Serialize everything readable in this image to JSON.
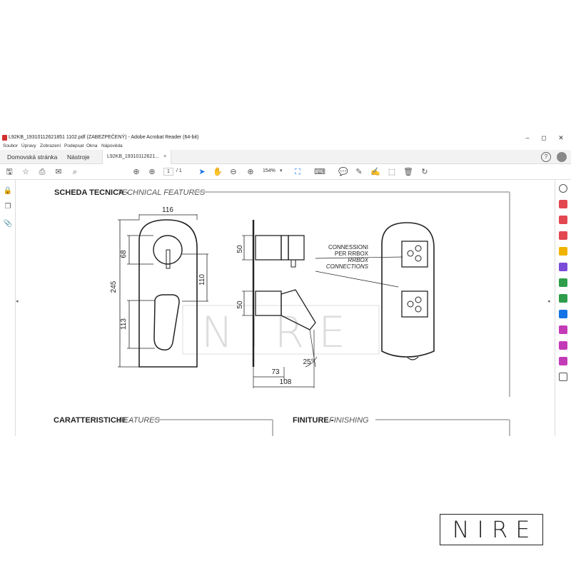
{
  "window": {
    "title": "L92KB_19310112621851 1102.pdf (ZABEZPEČENÝ) - Adobe Acrobat Reader (64-bit)",
    "minimize": "–",
    "maximize": "◻",
    "close": "✕"
  },
  "menu": [
    "Soubor",
    "Úpravy",
    "Zobrazení",
    "Podepsat",
    "Okna",
    "Nápověda"
  ],
  "tabs": {
    "home": "Domovská stránka",
    "tools": "Nástroje",
    "doc": "L92KB_19310112621...",
    "close": "×"
  },
  "toolbar": {
    "page_current": "1",
    "page_total": "/ 1",
    "zoom": "154%"
  },
  "document": {
    "tech_title_it": "SCHEDA TECNICA -",
    "tech_title_en": "TECHNICAL FEATURES",
    "dims": {
      "d116": "116",
      "d68": "68",
      "d245": "245",
      "d110": "110",
      "d113": "113",
      "d50a": "50",
      "d50b": "50",
      "d73": "73",
      "d108": "108",
      "d25": "25°"
    },
    "connections": [
      "CONNESSIONI",
      "PER RRBOX",
      "RRBOX",
      "CONNECTIONS"
    ],
    "watermark": "NIRE",
    "features_it": "CARATTERISTICHE -",
    "features_en": "FEATURES",
    "finishing_it": "FINITURE -",
    "finishing_en": "FINISHING"
  },
  "brand": "NIRE",
  "colors": {
    "acrobat_red": "#d32f2f",
    "accent_blue": "#1473e6"
  }
}
